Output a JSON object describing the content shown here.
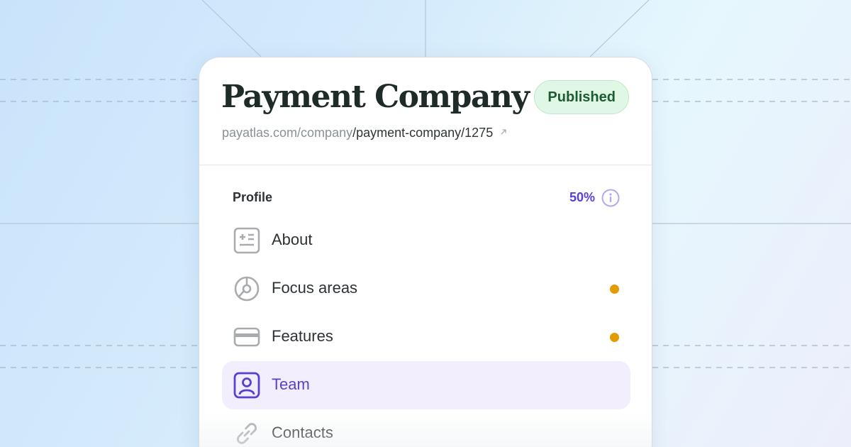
{
  "company": {
    "name": "Payment Company",
    "status": "Published",
    "url_base": "payatlas.com/company",
    "url_path": "/payment-company/1275"
  },
  "profile": {
    "title": "Profile",
    "progress": "50%",
    "progress_value": 50
  },
  "nav": {
    "items": [
      {
        "label": "About",
        "icon": "id-card-icon",
        "pending": false,
        "active": false
      },
      {
        "label": "Focus areas",
        "icon": "target-icon",
        "pending": true,
        "active": false
      },
      {
        "label": "Features",
        "icon": "credit-card-icon",
        "pending": true,
        "active": false
      },
      {
        "label": "Team",
        "icon": "user-icon",
        "pending": false,
        "active": true
      },
      {
        "label": "Contacts",
        "icon": "link-icon",
        "pending": false,
        "active": false
      }
    ]
  },
  "colors": {
    "accent": "#5b3fd0",
    "published_bg": "#e0f7e5",
    "published_text": "#1c5c34",
    "pending_dot": "#e29c00",
    "icon_gray": "#a9acaf"
  }
}
